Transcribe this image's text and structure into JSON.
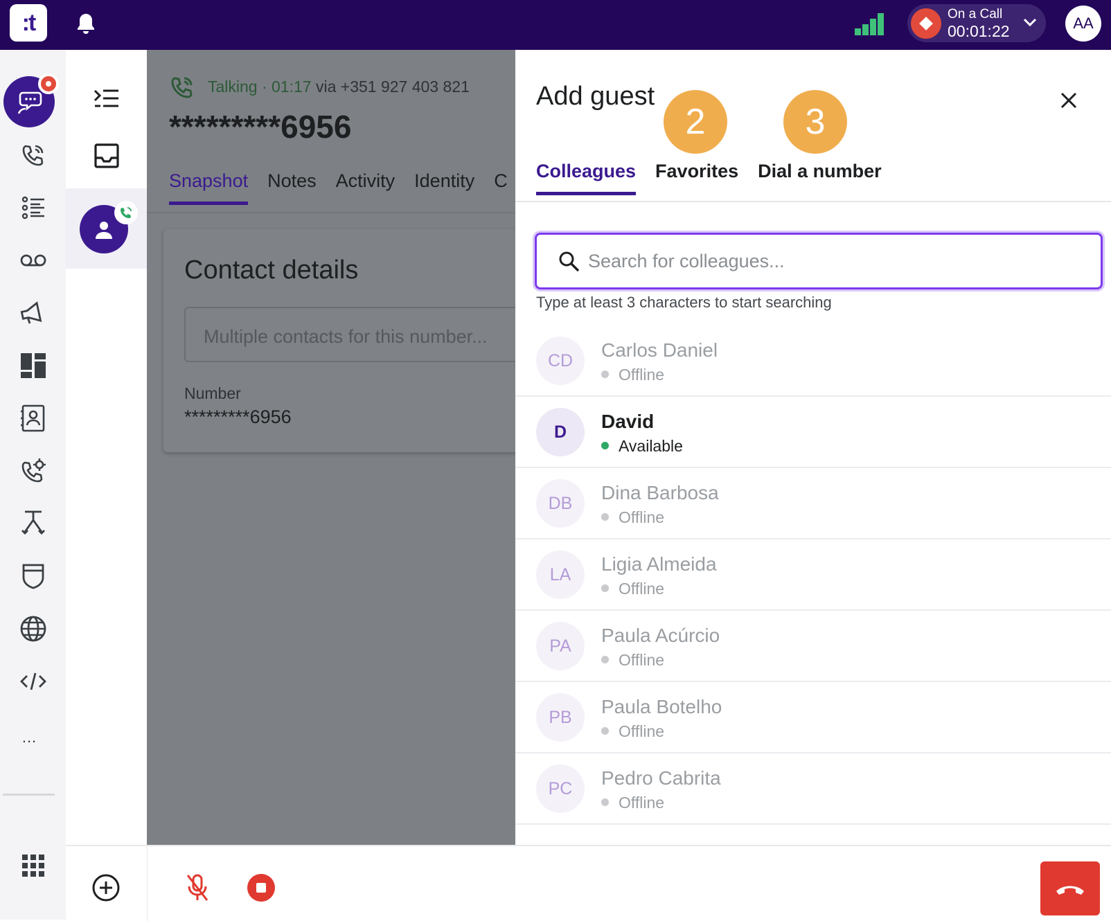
{
  "topbar": {
    "logo": ":t",
    "signal_color": "#3fc17a",
    "call_status": {
      "label": "On a Call",
      "timer": "00:01:22"
    },
    "user_initials": "AA"
  },
  "rail": {
    "items": [
      "conversations-icon",
      "calls-icon",
      "list-icon",
      "voicemail-icon",
      "campaigns-icon",
      "dashboard-icon",
      "contacts-icon",
      "call-settings-icon",
      "routing-icon",
      "security-icon",
      "globe-icon",
      "code-icon"
    ],
    "more": "..."
  },
  "conversation": {
    "status": "Talking · 01:17",
    "via": "via +351 927 403 821",
    "number": "*********6956",
    "tabs": [
      "Snapshot",
      "Notes",
      "Activity",
      "Identity",
      "C"
    ],
    "active_tab": "Snapshot",
    "card": {
      "title": "Contact details",
      "input_placeholder": "Multiple contacts for this number...",
      "number_label": "Number",
      "number_value": "*********6956"
    }
  },
  "panel": {
    "title": "Add guest",
    "steps": [
      "2",
      "3"
    ],
    "tabs": [
      "Colleagues",
      "Favorites",
      "Dial a number"
    ],
    "active_tab": "Colleagues",
    "search_placeholder": "Search for colleagues...",
    "search_value": "",
    "hint": "Type at least 3 characters to start searching",
    "colleagues": [
      {
        "initials": "CD",
        "name": "Carlos Daniel",
        "status": "Offline"
      },
      {
        "initials": "D",
        "name": "David",
        "status": "Available"
      },
      {
        "initials": "DB",
        "name": "Dina Barbosa",
        "status": "Offline"
      },
      {
        "initials": "LA",
        "name": "Ligia Almeida",
        "status": "Offline"
      },
      {
        "initials": "PA",
        "name": "Paula Acúrcio",
        "status": "Offline"
      },
      {
        "initials": "PB",
        "name": "Paula Botelho",
        "status": "Offline"
      },
      {
        "initials": "PC",
        "name": "Pedro Cabrita",
        "status": "Offline"
      }
    ]
  },
  "colors": {
    "brand": "#23065a",
    "accent": "#3b1a8f",
    "available": "#2fa866",
    "danger": "#e0392f",
    "step": "#f0ad4e"
  }
}
